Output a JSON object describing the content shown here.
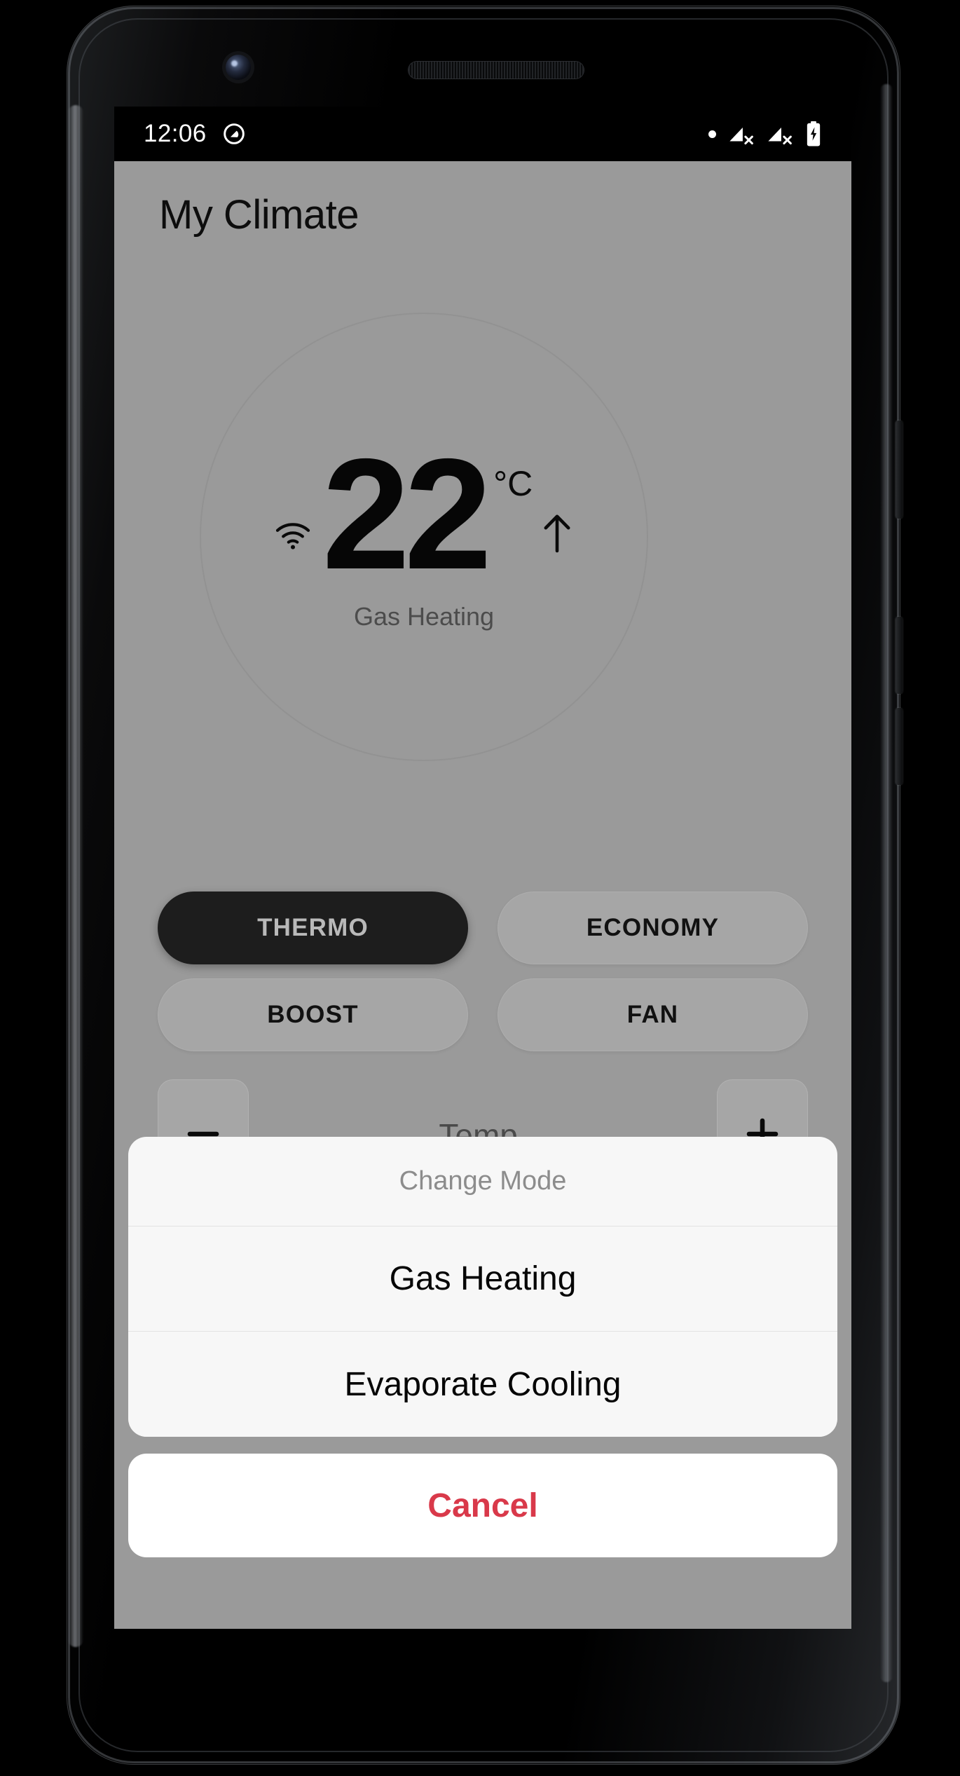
{
  "status_bar": {
    "time": "12:06",
    "icons": [
      "android-q-icon",
      "status-dot",
      "cellular-no-signal-icon",
      "cellular-no-signal-icon",
      "battery-charging-icon"
    ]
  },
  "app": {
    "title": "My Climate",
    "dial": {
      "temperature": "22",
      "unit": "°C",
      "mode_label": "Gas Heating",
      "wifi_icon": "wifi-icon",
      "trend_icon": "arrow-up-icon"
    },
    "mode_buttons": [
      {
        "label": "THERMO",
        "active": true
      },
      {
        "label": "ECONOMY",
        "active": false
      },
      {
        "label": "BOOST",
        "active": false
      },
      {
        "label": "FAN",
        "active": false
      }
    ],
    "stepper": {
      "label": "Temp.",
      "decrease_icon": "minus-icon",
      "increase_icon": "plus-icon"
    }
  },
  "action_sheet": {
    "title": "Change Mode",
    "options": [
      {
        "label": "Gas Heating"
      },
      {
        "label": "Evaporate Cooling"
      }
    ],
    "cancel_label": "Cancel",
    "cancel_color": "#d9394a"
  },
  "colors": {
    "scrim_background": "#9a9a9a",
    "button_inactive": "#a6a6a6",
    "button_active": "#1d1d1d",
    "sheet_background": "#f7f7f7",
    "cancel_red": "#d9394a"
  }
}
